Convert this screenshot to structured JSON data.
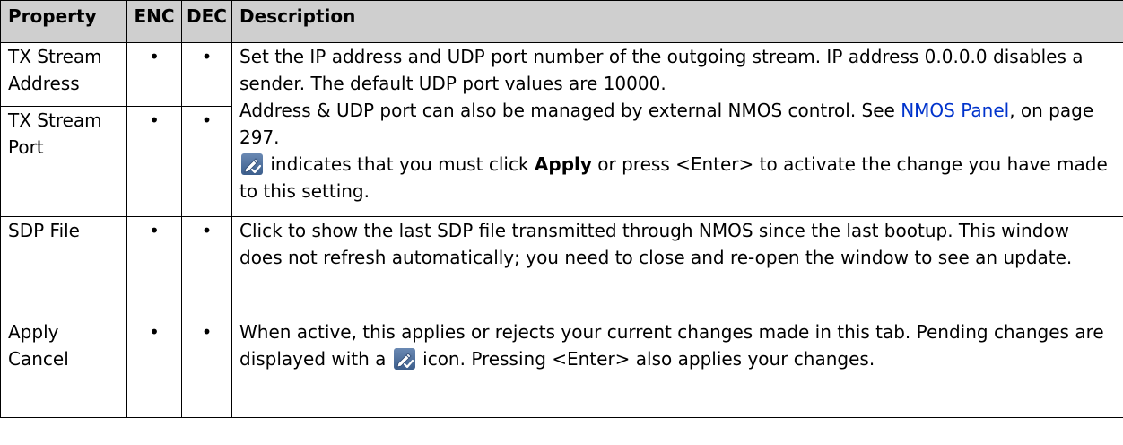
{
  "table": {
    "headers": [
      "Property",
      "ENC",
      "DEC",
      "Description"
    ],
    "rows": [
      {
        "property": "TX Stream Address",
        "enc": "•",
        "dec": "•"
      },
      {
        "property": "TX Stream Port",
        "enc": "•",
        "dec": "•"
      },
      {
        "property": "SDP File",
        "enc": "•",
        "dec": "•",
        "description": "Click to show the last SDP file transmitted through NMOS since the last bootup. This window does not refresh automatically; you need to close and re-open the window to see an update."
      },
      {
        "property_line1": "Apply",
        "property_line2": "Cancel",
        "enc": "•",
        "dec": "•"
      }
    ],
    "tx_description": {
      "para1": "Set the IP address and UDP port number of the outgoing stream. IP address 0.0.0.0 disables a sender. The default UDP port values are 10000.",
      "para2_prefix": "Address & UDP port can also be managed by external NMOS control. See ",
      "para2_link": "NMOS Panel",
      "para2_suffix": ", on page 297.",
      "para3_a": " indicates that you must click ",
      "para3_bold1": "Apply",
      "para3_b": " or press <Enter> to activate the change you have made to this setting."
    },
    "apply_description": {
      "part1": "When active, this applies or rejects your current changes made in this tab. Pending changes are displayed with a ",
      "part2": " icon. Pressing <Enter> also applies your changes."
    }
  },
  "icons": {
    "pending_change": "pencil-check-icon"
  },
  "colors": {
    "header_bg": "#cfcfcf",
    "link": "#0033cc",
    "icon_bg": "#4a6c9a"
  }
}
